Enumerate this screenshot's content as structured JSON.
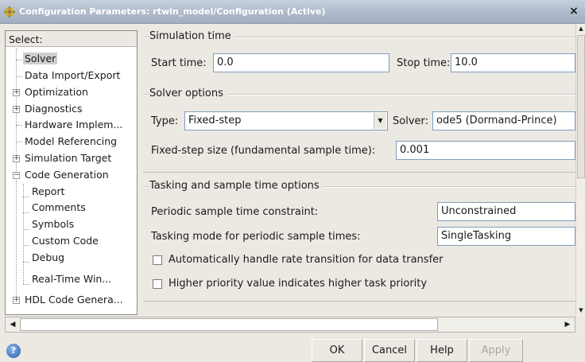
{
  "window": {
    "title": "Configuration Parameters: rtwin_model/Configuration (Active)",
    "close_label": "×"
  },
  "tree": {
    "header": "Select:",
    "items": [
      {
        "label": "Solver"
      },
      {
        "label": "Data Import/Export"
      },
      {
        "label": "Optimization"
      },
      {
        "label": "Diagnostics"
      },
      {
        "label": "Hardware Implem..."
      },
      {
        "label": "Model Referencing"
      },
      {
        "label": "Simulation Target"
      },
      {
        "label": "Code Generation"
      },
      {
        "label": "Report"
      },
      {
        "label": "Comments"
      },
      {
        "label": "Symbols"
      },
      {
        "label": "Custom Code"
      },
      {
        "label": "Debug"
      },
      {
        "label": "Real-Time Win..."
      },
      {
        "label": "HDL Code Genera..."
      }
    ],
    "selected": "Solver"
  },
  "simulation_time": {
    "group_title": "Simulation time",
    "start_label": "Start time:",
    "start_value": "0.0",
    "stop_label": "Stop time:",
    "stop_value": "10.0"
  },
  "solver_options": {
    "group_title": "Solver options",
    "type_label": "Type:",
    "type_value": "Fixed-step",
    "solver_label": "Solver:",
    "solver_value": "ode5 (Dormand-Prince)",
    "step_label": "Fixed-step size (fundamental sample time):",
    "step_value": "0.001"
  },
  "tasking": {
    "group_title": "Tasking and sample time options",
    "periodic_label": "Periodic sample time constraint:",
    "periodic_value": "Unconstrained",
    "mode_label": "Tasking mode for periodic sample times:",
    "mode_value": "SingleTasking",
    "auto_rate_label": "Automatically handle rate transition for data transfer",
    "auto_rate_checked": false,
    "priority_label": "Higher priority value indicates higher task priority",
    "priority_checked": false
  },
  "buttons": {
    "ok": "OK",
    "cancel": "Cancel",
    "help": "Help",
    "apply": "Apply"
  },
  "help_icon_glyph": "?"
}
